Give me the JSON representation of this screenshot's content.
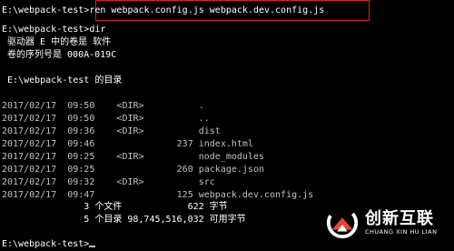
{
  "console": {
    "lines": [
      {
        "text": "E:\\webpack-test>ren webpack.config.js webpack.dev.config.js"
      },
      {
        "text": ""
      },
      {
        "text": "E:\\webpack-test>dir"
      },
      {
        "text": " 驱动器 E 中的卷是 软件"
      },
      {
        "text": " 卷的序列号是 000A-019C"
      },
      {
        "text": ""
      },
      {
        "text": " E:\\webpack-test 的目录"
      },
      {
        "text": ""
      },
      {
        "text": "2017/02/17  09:50    <DIR>          ."
      },
      {
        "text": "2017/02/17  09:50    <DIR>          .."
      },
      {
        "text": "2017/02/17  09:36    <DIR>          dist"
      },
      {
        "text": "2017/02/17  09:46               237 index.html"
      },
      {
        "text": "2017/02/17  09:25    <DIR>          node_modules"
      },
      {
        "text": "2017/02/17  09:25               260 package.json"
      },
      {
        "text": "2017/02/17  09:32    <DIR>          src"
      },
      {
        "text": "2017/02/17  09:47               125 webpack.dev.config.js"
      },
      {
        "text": "               3 个文件            622 字节"
      },
      {
        "text": "               5 个目录 98,745,516,032 可用字节"
      },
      {
        "text": ""
      },
      {
        "text": "E:\\webpack-test>"
      }
    ]
  },
  "watermark": {
    "name_cn": "创新互联",
    "name_en": "CHUANG XIN HU LIAN",
    "colors": {
      "accent": "#e8452c",
      "text": "#ffffff"
    }
  }
}
